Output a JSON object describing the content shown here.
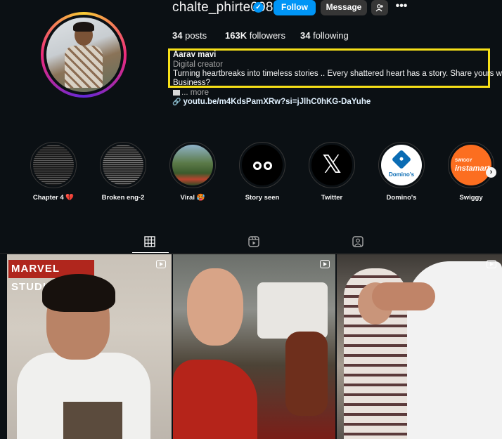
{
  "profile": {
    "username": "chalte_phirte098",
    "follow_label": "Follow",
    "message_label": "Message",
    "more_label": "•••",
    "stats": {
      "posts": "34",
      "posts_label": "posts",
      "followers": "163K",
      "followers_label": "followers",
      "following": "34",
      "following_label": "following"
    },
    "bio": {
      "name": "Aarav mavi",
      "category": "Digital creator",
      "line1": "Turning heartbreaks into timeless stories .. Every shattered heart has a story. Share yours with me!",
      "line2": "Business?",
      "more": "... more",
      "link": "youtu.be/m4KdsPamXRw?si=jJlhC0hKG-DaYuhe"
    }
  },
  "highlights": [
    {
      "label": "Chapter 4 💔"
    },
    {
      "label": "Broken eng-2"
    },
    {
      "label": "Viral 🥵"
    },
    {
      "label": "Story seen"
    },
    {
      "label": "Twitter"
    },
    {
      "label": "Domino's"
    },
    {
      "label": "Swiggy"
    }
  ],
  "highlight_art": {
    "dominos_text": "Domino's",
    "swiggy_small": "SWIGGY",
    "swiggy_big": "instamart",
    "x_glyph": "𝕏"
  },
  "posts": [
    {
      "overlay": "MARVEL STUDIOS"
    },
    {
      "overlay": ""
    },
    {
      "overlay": ""
    }
  ],
  "colors": {
    "accent": "#0095f6",
    "highlight_box": "#f7e018",
    "background": "#0b1014"
  },
  "icons": [
    "verified-badge-icon",
    "add-user-icon",
    "link-icon",
    "grid-icon",
    "reels-icon",
    "tagged-icon",
    "chevron-right-icon",
    "reel-icon"
  ]
}
